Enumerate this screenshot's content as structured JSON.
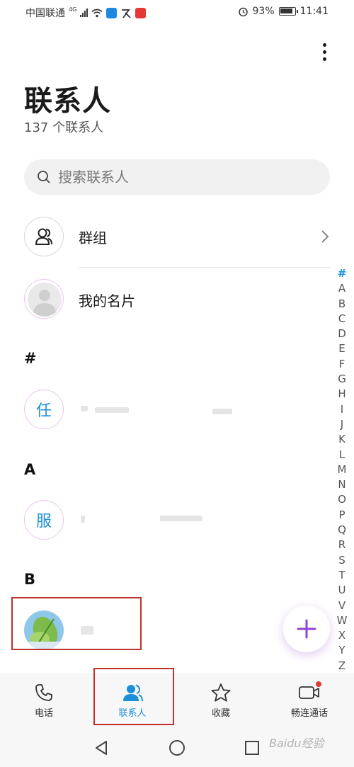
{
  "status_bar": {
    "carrier": "中国联通",
    "network_type": "4G",
    "battery": "93%",
    "time": "11:41",
    "icons": [
      "signal-icon",
      "wifi-icon",
      "app-notification-icon",
      "alarm-icon",
      "battery-icon"
    ]
  },
  "header": {
    "title": "联系人",
    "subtitle": "137 个联系人"
  },
  "search": {
    "placeholder": "搜索联系人"
  },
  "rows": {
    "groups": "群组",
    "my_card": "我的名片"
  },
  "sections": [
    {
      "header": "#",
      "avatar_text": "任"
    },
    {
      "header": "A",
      "avatar_text": "服"
    },
    {
      "header": "B",
      "avatar_text": ""
    }
  ],
  "index": [
    "#",
    "A",
    "B",
    "C",
    "D",
    "E",
    "F",
    "G",
    "H",
    "I",
    "J",
    "K",
    "L",
    "M",
    "N",
    "O",
    "P",
    "Q",
    "R",
    "S",
    "T",
    "U",
    "V",
    "W",
    "X",
    "Y",
    "Z"
  ],
  "bottom_nav": [
    {
      "label": "电话",
      "icon": "phone-icon",
      "active": false
    },
    {
      "label": "联系人",
      "icon": "contacts-icon",
      "active": true
    },
    {
      "label": "收藏",
      "icon": "star-icon",
      "active": false
    },
    {
      "label": "畅连通话",
      "icon": "video-call-icon",
      "active": false
    }
  ],
  "colors": {
    "accent": "#1d8fd8",
    "highlight_box": "#c0302c",
    "fab_plus": "#8e44d8",
    "badge": "#e53935"
  },
  "watermark": "Baidu经验"
}
